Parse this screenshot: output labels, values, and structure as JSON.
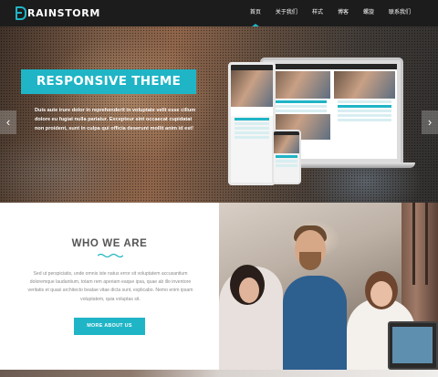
{
  "brand": {
    "logo_letter": "B",
    "logo_text": "RAINSTORM"
  },
  "nav": {
    "items": [
      {
        "label": "首页",
        "active": true
      },
      {
        "label": "关于我们",
        "active": false
      },
      {
        "label": "样式",
        "active": false
      },
      {
        "label": "博客",
        "active": false
      },
      {
        "label": "螺旋",
        "active": false
      },
      {
        "label": "联系我们",
        "active": false
      }
    ]
  },
  "hero": {
    "title": "RESPONSIVE THEME",
    "text": "Duis aute irure dolor in reprehenderit in voluptate velit esse cillum dolore eu fugiat nulla pariatur. Excepteur sint occaecat cupidatat non proident, sunt in culpa qui officia deserunt mollit anim id est!",
    "prev_arrow": "‹",
    "next_arrow": "›"
  },
  "who": {
    "title": "WHO WE ARE",
    "text": "Sed ut perspiciatis, unde omnis iste natus error sit voluptatem accusantium doloremque laudantium, totam rem aperiam eaque ipsa, quae ab illo inventore veritatis et quasi architecto beatae vitae dicta sunt, explicabo. Nemo enim ipsam voluptatem, quia voluptas sit.",
    "button_label": "MORE ABOUT US"
  },
  "colors": {
    "accent": "#1fb5c6",
    "navbar": "#1c1c1c",
    "body_text": "#8a8a8a",
    "heading": "#555555"
  },
  "icons": {
    "prev": "chevron-left-icon",
    "next": "chevron-right-icon",
    "divider": "wave-icon"
  }
}
